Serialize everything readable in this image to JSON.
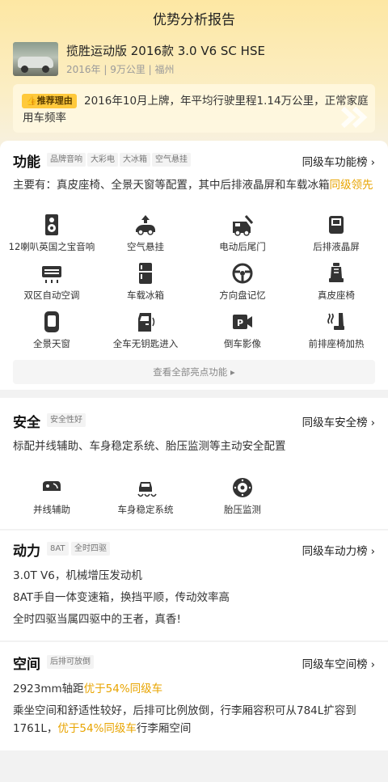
{
  "page": {
    "title": "优势分析报告"
  },
  "car": {
    "name": "揽胜运动版 2016款 3.0 V6 SC HSE",
    "meta": "2016年 | 9万公里 | 福州"
  },
  "reason": {
    "badge": "推荐理由",
    "text": "2016年10月上牌，年平均行驶里程1.14万公里，正常家庭用车频率"
  },
  "function": {
    "title": "功能",
    "tags": [
      "品牌音响",
      "大彩电",
      "大冰箱",
      "空气悬挂"
    ],
    "rank_link": "同级车功能榜",
    "summary_prefix": "主要有：真皮座椅、全景天窗等配置，其中后排液晶屏和车载冰箱",
    "summary_highlight": "同级领先",
    "features": [
      {
        "icon": "speaker-icon",
        "label": "12喇叭英国之宝音响"
      },
      {
        "icon": "air-suspension-icon",
        "label": "空气悬挂"
      },
      {
        "icon": "power-tailgate-icon",
        "label": "电动后尾门"
      },
      {
        "icon": "rear-screen-icon",
        "label": "后排液晶屏"
      },
      {
        "icon": "dual-zone-ac-icon",
        "label": "双区自动空调"
      },
      {
        "icon": "fridge-icon",
        "label": "车载冰箱"
      },
      {
        "icon": "steering-memory-icon",
        "label": "方向盘记忆"
      },
      {
        "icon": "leather-seat-icon",
        "label": "真皮座椅"
      },
      {
        "icon": "panoramic-roof-icon",
        "label": "全景天窗"
      },
      {
        "icon": "keyless-entry-icon",
        "label": "全车无钥匙进入"
      },
      {
        "icon": "reverse-camera-icon",
        "label": "倒车影像"
      },
      {
        "icon": "seat-heating-icon",
        "label": "前排座椅加热"
      }
    ],
    "more": "查看全部亮点功能"
  },
  "safety": {
    "title": "安全",
    "tag": "安全性好",
    "rank_link": "同级车安全榜",
    "summary": "标配并线辅助、车身稳定系统、胎压监测等主动安全配置",
    "features": [
      {
        "icon": "lane-change-assist-icon",
        "label": "并线辅助"
      },
      {
        "icon": "stability-control-icon",
        "label": "车身稳定系统"
      },
      {
        "icon": "tire-pressure-icon",
        "label": "胎压监测"
      }
    ]
  },
  "power": {
    "title": "动力",
    "tags": [
      "8AT",
      "全时四驱"
    ],
    "rank_link": "同级车动力榜",
    "lines": [
      "3.0T V6，机械增压发动机",
      "8AT手自一体变速箱，换挡平顺，传动效率高",
      "全时四驱当属四驱中的王者，真香!"
    ]
  },
  "space": {
    "title": "空间",
    "tag": "后排可放倒",
    "rank_link": "同级车空间榜",
    "line1_prefix": "2923mm轴距",
    "line1_highlight": "优于54%同级车",
    "line2_text": "乘坐空间和舒适性较好，后排可比例放倒，行李厢容积可从784L扩容到1761L，",
    "line2_highlight": "优于54%同级车",
    "line2_suffix": "行李厢空间"
  },
  "colors": {
    "accent": "#e8a400",
    "badge": "#ffc93c",
    "hero_top": "#fde7a3"
  }
}
